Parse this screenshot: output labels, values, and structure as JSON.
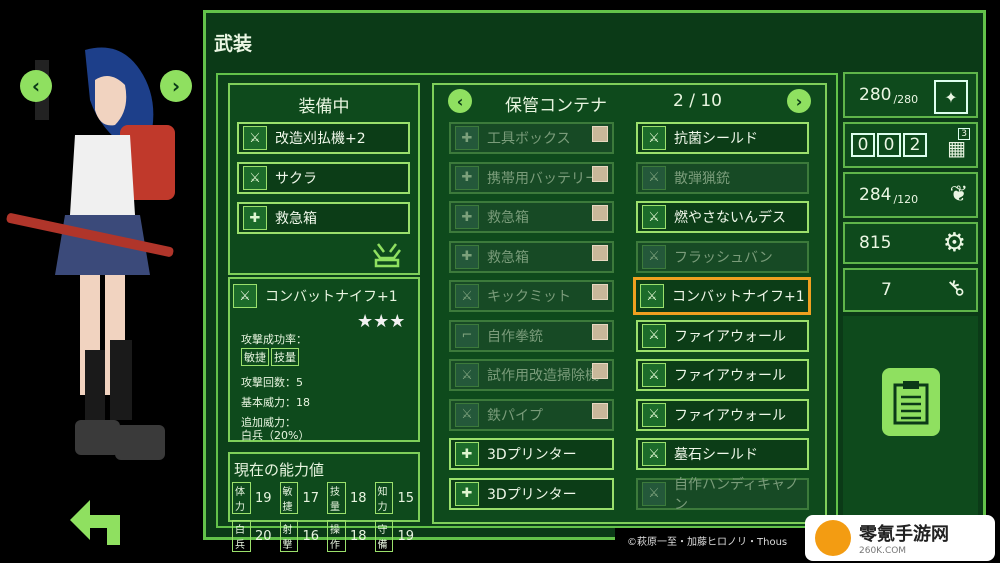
{
  "screen_title": "武装",
  "equipped": {
    "title": "装備中",
    "items": [
      {
        "label": "改造刈払機+2",
        "icon": "sword-icon"
      },
      {
        "label": "サクラ",
        "icon": "sword-icon"
      },
      {
        "label": "救急箱",
        "icon": "medkit-icon"
      }
    ]
  },
  "detail": {
    "name": "コンバットナイフ+1",
    "stars": "★★★",
    "hit_label": "攻撃成功率：",
    "hit_tags": [
      "敏捷",
      "技量"
    ],
    "attacks": "攻撃回数：5",
    "power": "基本威力：18",
    "extra_label": "追加威力：",
    "extra_value": "白兵（20%）"
  },
  "abilities": {
    "title": "現在の能力値",
    "rows": [
      [
        {
          "k": "体力",
          "v": "19"
        },
        {
          "k": "敏捷",
          "v": "17"
        },
        {
          "k": "技量",
          "v": "18"
        },
        {
          "k": "知力",
          "v": "15"
        }
      ],
      [
        {
          "k": "白兵",
          "v": "20"
        },
        {
          "k": "射撃",
          "v": "16"
        },
        {
          "k": "操作",
          "v": "18"
        },
        {
          "k": "守備",
          "v": "19"
        }
      ]
    ]
  },
  "storage": {
    "title": "保管コンテナ",
    "page": "2 / 10",
    "left": [
      {
        "label": "工具ボックス",
        "dim": true,
        "icon": "medkit-icon"
      },
      {
        "label": "携帯用バッテリー",
        "dim": true,
        "icon": "medkit-icon"
      },
      {
        "label": "救急箱",
        "dim": true,
        "icon": "medkit-icon"
      },
      {
        "label": "救急箱",
        "dim": true,
        "icon": "medkit-icon"
      },
      {
        "label": "キックミット",
        "dim": true,
        "icon": "sword-icon"
      },
      {
        "label": "自作拳銃",
        "dim": true,
        "icon": "gun-icon"
      },
      {
        "label": "試作用改造掃除機",
        "dim": true,
        "icon": "sword-icon"
      },
      {
        "label": "鉄パイプ",
        "dim": true,
        "icon": "sword-icon"
      },
      {
        "label": "3Dプリンター",
        "dim": false,
        "icon": "medkit-icon"
      },
      {
        "label": "3Dプリンター",
        "dim": false,
        "icon": "medkit-icon"
      }
    ],
    "right": [
      {
        "label": "抗菌シールド",
        "dim": false,
        "sel": false
      },
      {
        "label": "散弾猟銃",
        "dim": true,
        "sel": false
      },
      {
        "label": "燃やさないんデス",
        "dim": false,
        "sel": false
      },
      {
        "label": "フラッシュバン",
        "dim": true,
        "sel": false
      },
      {
        "label": "コンバットナイフ+1",
        "dim": false,
        "sel": true
      },
      {
        "label": "ファイアウォール",
        "dim": false,
        "sel": false
      },
      {
        "label": "ファイアウォール",
        "dim": false,
        "sel": false
      },
      {
        "label": "ファイアウォール",
        "dim": false,
        "sel": false
      },
      {
        "label": "墓石シールド",
        "dim": false,
        "sel": false
      },
      {
        "label": "自作ハンディキャノン",
        "dim": true,
        "sel": false
      }
    ]
  },
  "stats": {
    "hp": "280",
    "hp_max": "/280",
    "counter": [
      "0",
      "0",
      "2"
    ],
    "calendar_badge": "3",
    "food": "284",
    "food_max": "/120",
    "parts": "815",
    "keys": "7"
  },
  "copyright": "©萩原一至・加藤ヒロノリ・Thous",
  "watermark": "零氪手游网",
  "watermark_sub": "260K.COM",
  "colors": {
    "frame": "#63c24a",
    "bg": "#0b3a17",
    "select": "#f0a020"
  }
}
